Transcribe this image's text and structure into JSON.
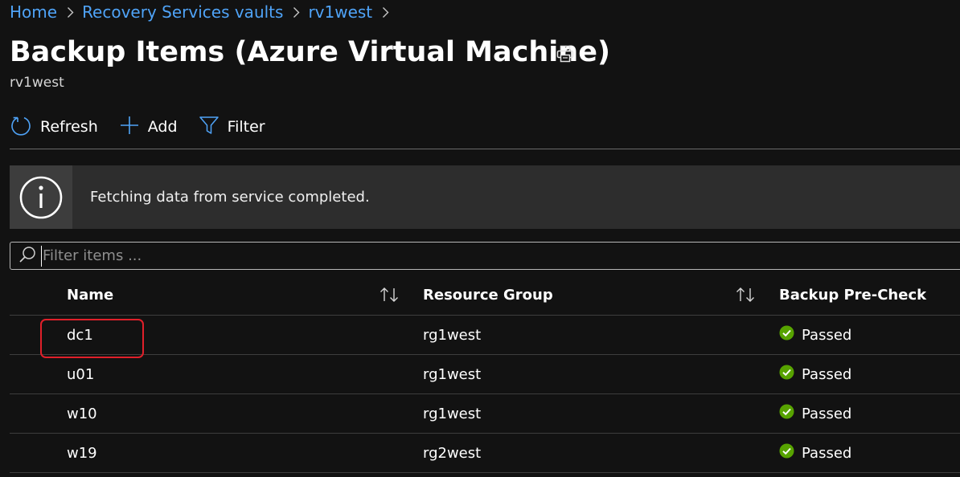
{
  "breadcrumb": {
    "items": [
      {
        "label": "Home"
      },
      {
        "label": "Recovery Services vaults"
      },
      {
        "label": "rv1west"
      }
    ]
  },
  "header": {
    "title": "Backup Items (Azure Virtual Machine)",
    "subtitle": "rv1west"
  },
  "toolbar": {
    "refresh_label": "Refresh",
    "add_label": "Add",
    "filter_label": "Filter"
  },
  "banner": {
    "text": "Fetching data from service completed."
  },
  "search": {
    "placeholder": "Filter items ...",
    "value": ""
  },
  "table": {
    "columns": [
      "Name",
      "Resource Group",
      "Backup Pre-Check"
    ],
    "rows": [
      {
        "name": "dc1",
        "resource_group": "rg1west",
        "precheck": "Passed"
      },
      {
        "name": "u01",
        "resource_group": "rg1west",
        "precheck": "Passed"
      },
      {
        "name": "w10",
        "resource_group": "rg1west",
        "precheck": "Passed"
      },
      {
        "name": "w19",
        "resource_group": "rg2west",
        "precheck": "Passed"
      }
    ]
  },
  "colors": {
    "accent": "#4fa3f7",
    "success": "#57a300",
    "highlight": "#e0202a"
  }
}
